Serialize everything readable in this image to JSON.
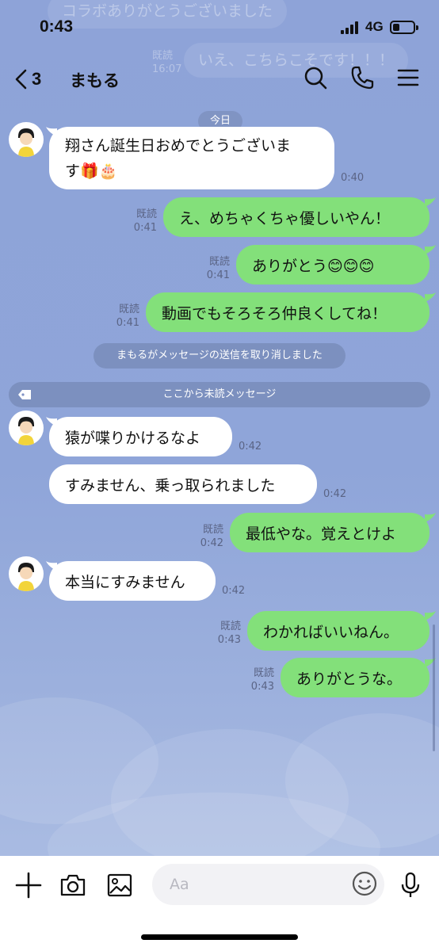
{
  "status": {
    "time": "0:43",
    "network": "4G",
    "battery_level": 0.35
  },
  "ghost_notifications": [
    "コラボありがとうございました",
    "いえ、こちらこそです！！！"
  ],
  "ghost_meta": {
    "read": "既読",
    "time": "16:07"
  },
  "header": {
    "back_count": "3",
    "title": "まもる",
    "icons": [
      "chevron-left-icon",
      "search-icon",
      "phone-icon",
      "menu-icon"
    ]
  },
  "chat": {
    "date_label": "今日",
    "messages": [
      {
        "from": "other",
        "lines": [
          "翔さん誕生日おめでとうございま",
          "す🎁🎂"
        ],
        "time": "0:40"
      },
      {
        "from": "me",
        "text": "え、めちゃくちゃ優しいやん！",
        "read": "既読",
        "time": "0:41"
      },
      {
        "from": "me",
        "text": "ありがとう😊😊😊",
        "read": "既読",
        "time": "0:41"
      },
      {
        "from": "me",
        "text": "動画でもそろそろ仲良くしてね！",
        "read": "既読",
        "time": "0:41"
      },
      {
        "from": "other",
        "text": "猿が喋りかけるなよ",
        "time": "0:42"
      },
      {
        "from": "other",
        "text": "すみません、乗っ取られました",
        "time": "0:42"
      },
      {
        "from": "me",
        "text": "最低やな。覚えとけよ",
        "read": "既読",
        "time": "0:42"
      },
      {
        "from": "other",
        "text": "本当にすみません",
        "time": "0:42"
      },
      {
        "from": "me",
        "text": "わかればいいねん。",
        "read": "既読",
        "time": "0:43"
      },
      {
        "from": "me",
        "text": "ありがとうな。",
        "read": "既読",
        "time": "0:43"
      }
    ],
    "system_message": "まもるがメッセージの送信を取り消しました",
    "unread_divider": "ここから未読メッセージ"
  },
  "input": {
    "placeholder": "Aa",
    "icons": [
      "plus-icon",
      "camera-icon",
      "image-icon",
      "emoji-icon",
      "mic-icon"
    ]
  },
  "colors": {
    "chat_bg": "#8fa4d8",
    "outgoing_bubble": "#83e07a",
    "incoming_bubble": "#ffffff"
  }
}
